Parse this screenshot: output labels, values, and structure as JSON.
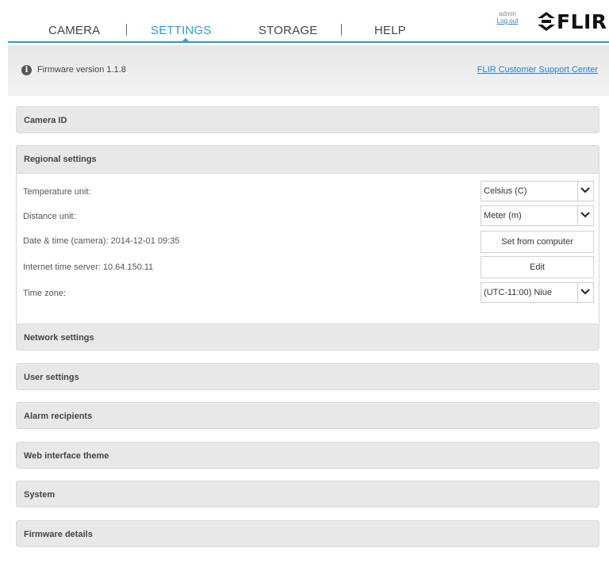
{
  "nav": {
    "tabs": [
      {
        "label": "CAMERA",
        "active": false
      },
      {
        "label": "SETTINGS",
        "active": true
      },
      {
        "label": "STORAGE",
        "active": false
      },
      {
        "label": "HELP",
        "active": false
      }
    ],
    "user": "admin",
    "logout": "Log out",
    "brand": "FLIR"
  },
  "info": {
    "firmware": "Firmware version 1.1.8",
    "support_link": "FLIR Customer Support Center"
  },
  "sections": {
    "camera_id": "Camera ID",
    "regional": "Regional settings",
    "network": "Network settings",
    "user": "User settings",
    "alarm": "Alarm recipients",
    "theme": "Web interface theme",
    "system": "System",
    "firmware_details": "Firmware details"
  },
  "regional": {
    "temp_label": "Temperature unit:",
    "temp_value": "Celsius (C)",
    "dist_label": "Distance unit:",
    "dist_value": "Meter (m)",
    "datetime_label": "Date & time (camera): 2014-12-01 09:35",
    "set_from_computer": "Set from computer",
    "ntp_label": "Internet time server: 10.64.150.11",
    "edit": "Edit",
    "tz_label": "Time zone:",
    "tz_value": "(UTC-11:00) Niue"
  },
  "colors": {
    "accent": "#2a9fd0",
    "link": "#2a7fd0",
    "panel_bg": "#e8e8e8"
  }
}
